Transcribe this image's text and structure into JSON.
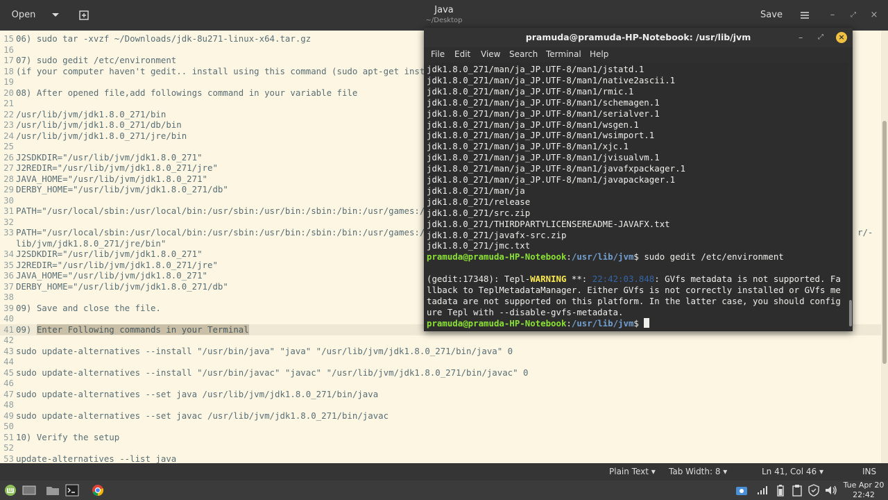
{
  "header": {
    "open_label": "Open",
    "title": "Java",
    "subtitle": "~/Desktop",
    "save_label": "Save"
  },
  "editor": {
    "lines": [
      {
        "n": "15",
        "t": "06) sudo tar -xvzf ~/Downloads/jdk-8u271-linux-x64.tar.gz"
      },
      {
        "n": "16",
        "t": ""
      },
      {
        "n": "17",
        "t": "07) sudo gedit /etc/environment"
      },
      {
        "n": "18",
        "t": "(if your computer haven't gedit.. install using this command (sudo apt-get inst"
      },
      {
        "n": "19",
        "t": ""
      },
      {
        "n": "20",
        "t": "08) After opened file,add followings command in your variable file"
      },
      {
        "n": "21",
        "t": ""
      },
      {
        "n": "22",
        "t": "/usr/lib/jvm/jdk1.8.0_271/bin"
      },
      {
        "n": "23",
        "t": "/usr/lib/jvm/jdk1.8.0_271/db/bin"
      },
      {
        "n": "24",
        "t": "/usr/lib/jvm/jdk1.8.0_271/jre/bin"
      },
      {
        "n": "25",
        "t": ""
      },
      {
        "n": "26",
        "t": "J2SDKDIR=\"/usr/lib/jvm/jdk1.8.0_271\""
      },
      {
        "n": "27",
        "t": "J2REDIR=\"/usr/lib/jvm/jdk1.8.0_271/jre\""
      },
      {
        "n": "28",
        "t": "JAVA_HOME=\"/usr/lib/jvm/jdk1.8.0_271\""
      },
      {
        "n": "29",
        "t": "DERBY_HOME=\"/usr/lib/jvm/jdk1.8.0_271/db\""
      },
      {
        "n": "30",
        "t": ""
      },
      {
        "n": "31",
        "t": "PATH=\"/usr/local/sbin:/usr/local/bin:/usr/sbin:/usr/bin:/sbin:/bin:/usr/games:/"
      },
      {
        "n": "32",
        "t": ""
      },
      {
        "n": "33",
        "t": "PATH=\"/usr/local/sbin:/usr/local/bin:/usr/sbin:/usr/bin:/sbin:/bin:/usr/games:/"
      },
      {
        "n": "",
        "t": "lib/jvm/jdk1.8.0_271/jre/bin\""
      },
      {
        "n": "34",
        "t": "J2SDKDIR=\"/usr/lib/jvm/jdk1.8.0_271\""
      },
      {
        "n": "35",
        "t": "J2REDIR=\"/usr/lib/jvm/jdk1.8.0_271/jre\""
      },
      {
        "n": "36",
        "t": "JAVA_HOME=\"/usr/lib/jvm/jdk1.8.0_271\""
      },
      {
        "n": "37",
        "t": "DERBY_HOME=\"/usr/lib/jvm/jdk1.8.0_271/db\""
      },
      {
        "n": "38",
        "t": ""
      },
      {
        "n": "39",
        "t": "09) Save and close the file."
      },
      {
        "n": "40",
        "t": ""
      },
      {
        "n": "41",
        "t": "09) ",
        "sel": "Enter Following commands in your Terminal"
      },
      {
        "n": "42",
        "t": ""
      },
      {
        "n": "43",
        "t": "sudo update-alternatives --install \"/usr/bin/java\" \"java\" \"/usr/lib/jvm/jdk1.8.0_271/bin/java\" 0"
      },
      {
        "n": "44",
        "t": ""
      },
      {
        "n": "45",
        "t": "sudo update-alternatives --install \"/usr/bin/javac\" \"javac\" \"/usr/lib/jvm/jdk1.8.0_271/bin/javac\" 0"
      },
      {
        "n": "46",
        "t": ""
      },
      {
        "n": "47",
        "t": "sudo update-alternatives --set java /usr/lib/jvm/jdk1.8.0_271/bin/java"
      },
      {
        "n": "48",
        "t": ""
      },
      {
        "n": "49",
        "t": "sudo update-alternatives --set javac /usr/lib/jvm/jdk1.8.0_271/bin/javac"
      },
      {
        "n": "50",
        "t": ""
      },
      {
        "n": "51",
        "t": "10) Verify the setup"
      },
      {
        "n": "52",
        "t": ""
      },
      {
        "n": "53",
        "t": "update-alternatives --list java"
      }
    ],
    "line33_tail": "r/-"
  },
  "statusbar": {
    "lang": "Plain Text",
    "tab_width": "Tab Width: 8",
    "position": "Ln 41, Col 46",
    "mode": "INS"
  },
  "terminal": {
    "title": "pramuda@pramuda-HP-Notebook: /usr/lib/jvm",
    "menu": [
      "File",
      "Edit",
      "View",
      "Search",
      "Terminal",
      "Help"
    ],
    "output": [
      "jdk1.8.0_271/man/ja_JP.UTF-8/man1/jstatd.1",
      "jdk1.8.0_271/man/ja_JP.UTF-8/man1/native2ascii.1",
      "jdk1.8.0_271/man/ja_JP.UTF-8/man1/rmic.1",
      "jdk1.8.0_271/man/ja_JP.UTF-8/man1/schemagen.1",
      "jdk1.8.0_271/man/ja_JP.UTF-8/man1/serialver.1",
      "jdk1.8.0_271/man/ja_JP.UTF-8/man1/wsgen.1",
      "jdk1.8.0_271/man/ja_JP.UTF-8/man1/wsimport.1",
      "jdk1.8.0_271/man/ja_JP.UTF-8/man1/xjc.1",
      "jdk1.8.0_271/man/ja_JP.UTF-8/man1/jvisualvm.1",
      "jdk1.8.0_271/man/ja_JP.UTF-8/man1/javafxpackager.1",
      "jdk1.8.0_271/man/ja_JP.UTF-8/man1/javapackager.1",
      "jdk1.8.0_271/man/ja",
      "jdk1.8.0_271/release",
      "jdk1.8.0_271/src.zip",
      "jdk1.8.0_271/THIRDPARTYLICENSEREADME-JAVAFX.txt",
      "jdk1.8.0_271/javafx-src.zip",
      "jdk1.8.0_271/jmc.txt"
    ],
    "prompt_user": "pramuda@pramuda-HP-Notebook",
    "prompt_path": "/usr/lib/jvm",
    "prompt_sign": "$",
    "command": " sudo gedit /etc/environment",
    "warn_prefix": "(gedit:17348): Tepl-",
    "warn_word": "WARNING",
    "warn_stars": " **: ",
    "warn_time": "22:42:03.848",
    "warn_msg": [
      ": GVfs metadata is not supported. Fa",
      "llback to TeplMetadataManager. Either GVfs is not correctly installed or GVfs me",
      "tadata are not supported on this platform. In the latter case, you should config",
      "ure Tepl with --disable-gvfs-metadata."
    ]
  },
  "taskbar": {
    "clock_day": "Tue Apr 20",
    "clock_time": "22:42"
  }
}
